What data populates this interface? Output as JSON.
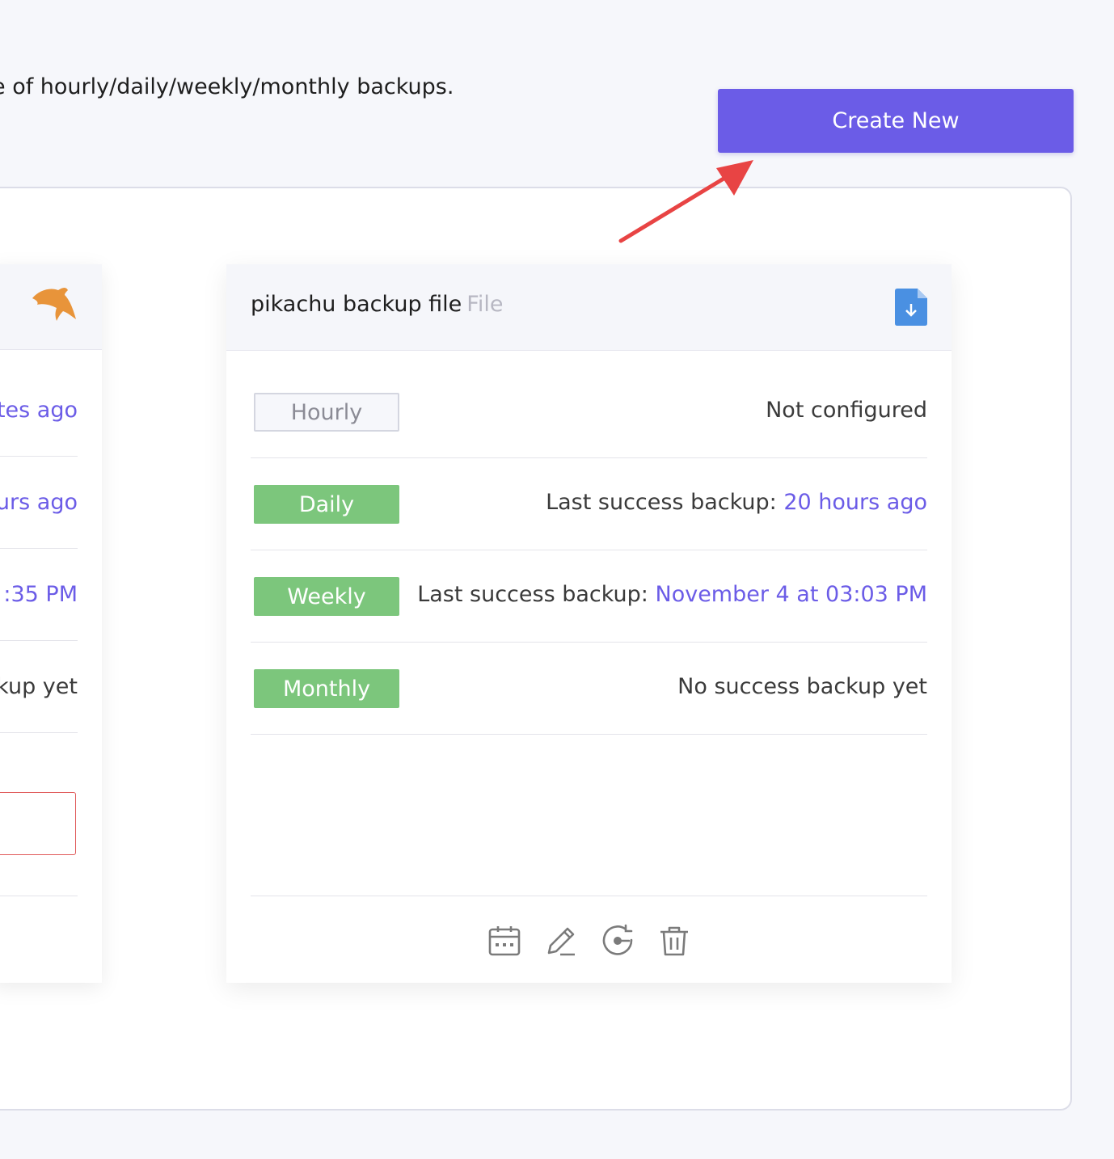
{
  "intro_text": "e of hourly/daily/weekly/monthly backups.",
  "create_button": "Create New",
  "left_card": {
    "rows": [
      {
        "text": "tes ago",
        "kind": "link"
      },
      {
        "text": "urs ago",
        "kind": "link"
      },
      {
        "text": ":35 PM",
        "kind": "link"
      },
      {
        "text": "kup yet",
        "kind": "plain"
      }
    ]
  },
  "card": {
    "title": "pikachu backup file",
    "type_label": "File",
    "schedules": [
      {
        "label": "Hourly",
        "enabled": false,
        "prefix": "",
        "value": "Not configured"
      },
      {
        "label": "Daily",
        "enabled": true,
        "prefix": "Last success backup:",
        "value": "20 hours ago"
      },
      {
        "label": "Weekly",
        "enabled": true,
        "prefix": "Last success backup:",
        "value": "November 4 at 03:03 PM"
      },
      {
        "label": "Monthly",
        "enabled": true,
        "prefix": "",
        "value": "No success backup yet"
      }
    ],
    "actions": [
      "calendar-icon",
      "edit-icon",
      "restore-icon",
      "trash-icon"
    ]
  },
  "colors": {
    "accent": "#6b5ce7",
    "badge_on": "#7cc67c",
    "annotation_arrow": "#e84444"
  }
}
